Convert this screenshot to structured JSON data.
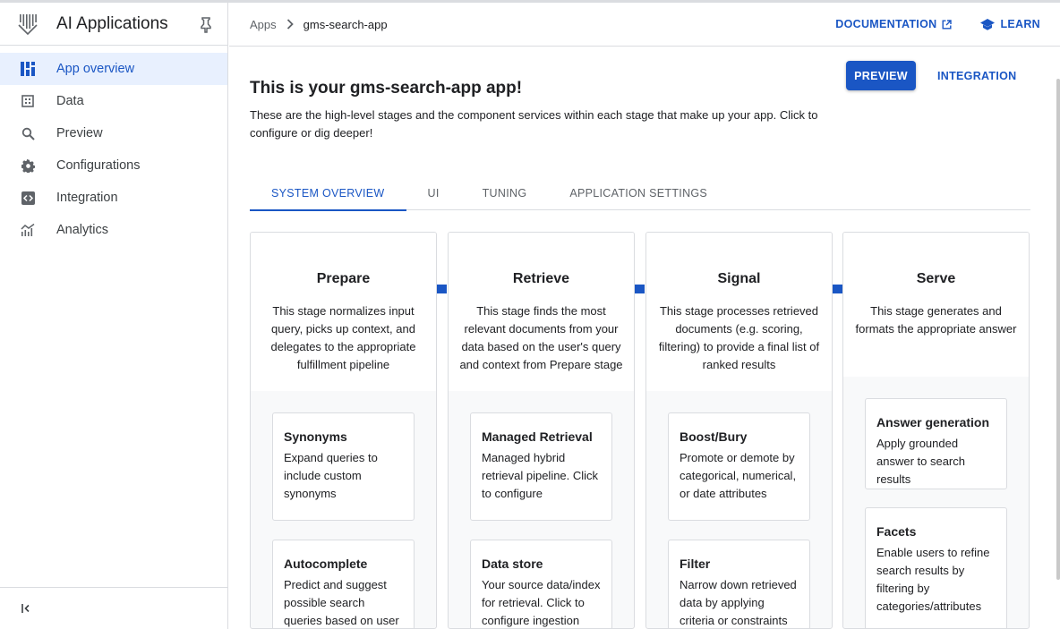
{
  "app": {
    "title": "AI Applications"
  },
  "sidebar": {
    "items": [
      {
        "label": "App overview",
        "icon": "dashboard-icon",
        "active": true
      },
      {
        "label": "Data",
        "icon": "data-icon"
      },
      {
        "label": "Preview",
        "icon": "search-icon"
      },
      {
        "label": "Configurations",
        "icon": "gear-icon"
      },
      {
        "label": "Integration",
        "icon": "code-icon"
      },
      {
        "label": "Analytics",
        "icon": "analytics-icon"
      }
    ]
  },
  "breadcrumb": {
    "root": "Apps",
    "current": "gms-search-app"
  },
  "header_links": {
    "documentation": "DOCUMENTATION",
    "learn": "LEARN"
  },
  "page": {
    "title": "This is your gms-search-app app!",
    "description": "These are the high-level stages and the component services within each stage that make up your app. Click to configure or dig deeper!",
    "preview_button": "PREVIEW",
    "integration_button": "INTEGRATION"
  },
  "tabs": [
    "SYSTEM OVERVIEW",
    "UI",
    "TUNING",
    "APPLICATION SETTINGS"
  ],
  "stages": [
    {
      "name": "Prepare",
      "description": "This stage normalizes input query, picks up context, and delegates to the appropriate fulfillment pipeline",
      "services": [
        {
          "name": "Synonyms",
          "description": "Expand queries to include custom synonyms"
        },
        {
          "name": "Autocomplete",
          "description": "Predict and suggest possible search queries based on user input"
        }
      ]
    },
    {
      "name": "Retrieve",
      "description": "This stage finds the most relevant documents from your data based on the user's query and context from Prepare stage",
      "services": [
        {
          "name": "Managed Retrieval",
          "description": "Managed hybrid retrieval pipeline. Click to configure"
        },
        {
          "name": "Data store",
          "description": "Your source data/index for retrieval. Click to configure ingestion"
        }
      ]
    },
    {
      "name": "Signal",
      "description": "This stage processes retrieved documents (e.g. scoring, filtering) to provide a final list of ranked results",
      "services": [
        {
          "name": "Boost/Bury",
          "description": "Promote or demote by categorical, numerical, or date attributes"
        },
        {
          "name": "Filter",
          "description": "Narrow down retrieved data by applying criteria or constraints"
        }
      ]
    },
    {
      "name": "Serve",
      "description": "This stage generates and formats the appropriate answer",
      "services": [
        {
          "name": "Answer generation",
          "description": "Apply grounded answer to search results"
        },
        {
          "name": "Facets",
          "description": "Enable users to refine search results by filtering by categories/attributes"
        }
      ]
    }
  ],
  "colors": {
    "accent": "#1a56c4",
    "active_bg": "#e8f0fe"
  }
}
